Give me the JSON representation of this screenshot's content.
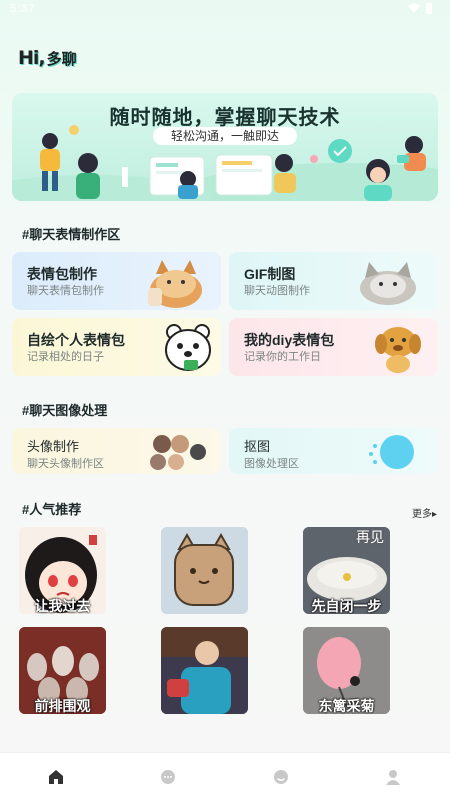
{
  "status_bar": {
    "time": "5:37"
  },
  "logo": {
    "hi": "Hi,",
    "name": "多聊"
  },
  "banner": {
    "title": "随时随地，掌握聊天技术",
    "subtitle": "轻松沟通，一触即达"
  },
  "sections": {
    "emoji": "#聊天表情制作区",
    "image": "#聊天图像处理",
    "popular": "#人气推荐",
    "more": "更多▸"
  },
  "emoji_cards": [
    {
      "title": "表情包制作",
      "subtitle": "聊天表情包制作"
    },
    {
      "title": "GIF制图",
      "subtitle": "聊天动图制作"
    },
    {
      "title": "自绘个人表情包",
      "subtitle": "记录相处的日子"
    },
    {
      "title": "我的diy表情包",
      "subtitle": "记录你的工作日"
    }
  ],
  "image_cards": [
    {
      "title": "头像制作",
      "subtitle": "聊天头像制作区"
    },
    {
      "title": "抠图",
      "subtitle": "图像处理区"
    }
  ],
  "popular": [
    {
      "caption": "让我过去",
      "caption_top": ""
    },
    {
      "caption": "",
      "caption_top": ""
    },
    {
      "caption": "先自闭一步",
      "caption_top": "再见"
    },
    {
      "caption": "前排围观",
      "caption_top": ""
    },
    {
      "caption": "",
      "caption_top": ""
    },
    {
      "caption": "东篱采菊",
      "caption_top": ""
    }
  ],
  "tabs": [
    {
      "icon": "home-icon"
    },
    {
      "icon": "chat-icon"
    },
    {
      "icon": "emoji-icon"
    },
    {
      "icon": "profile-icon"
    }
  ],
  "colors": {
    "accent": "#5ed9c3",
    "active_tab": "#333333",
    "inactive_tab": "#c8c8c8"
  }
}
